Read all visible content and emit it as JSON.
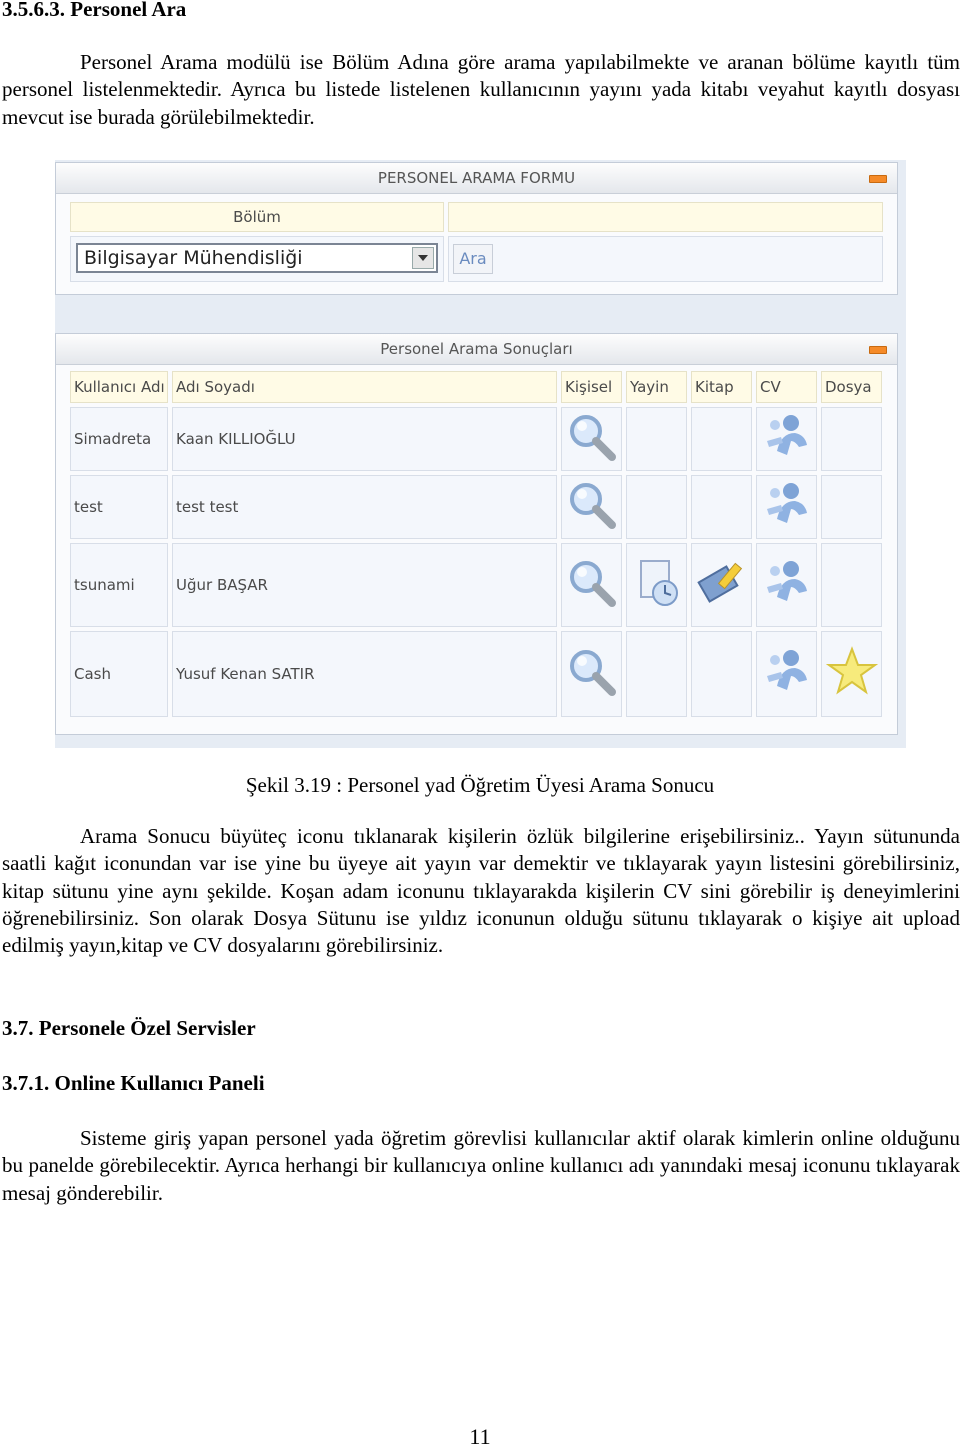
{
  "section_heading": "3.5.6.3. Personel Ara",
  "intro_paragraph": "Personel Arama modülü ise Bölüm Adına göre arama yapılabilmekte ve aranan bölüme kayıtlı tüm personel listelenmektedir. Ayrıca bu listede listelenen kullanıcının yayını yada kitabı veyahut kayıtlı dosyası mevcut ise burada görülebilmektedir.",
  "search_form": {
    "title": "PERSONEL ARAMA FORMU",
    "field_label": "Bölüm",
    "selected_department": "Bilgisayar Mühendisliği",
    "search_button": "Ara"
  },
  "results": {
    "title": "Personel Arama Sonuçları",
    "columns": [
      "Kullanıcı Adı",
      "Adı Soyadı",
      "Kişisel",
      "Yayin",
      "Kitap",
      "CV",
      "Dosya"
    ],
    "rows": [
      {
        "username": "Simadreta",
        "fullname": "Kaan KILLIOĞLU",
        "kisisel": "magnifier-icon",
        "yayin": "",
        "kitap": "",
        "cv": "person-icon",
        "dosya": ""
      },
      {
        "username": "test",
        "fullname": "test test",
        "kisisel": "magnifier-icon",
        "yayin": "",
        "kitap": "",
        "cv": "person-icon",
        "dosya": ""
      },
      {
        "username": "tsunami",
        "fullname": "Uğur BAŞAR",
        "kisisel": "magnifier-icon",
        "yayin": "clock-paper-icon",
        "kitap": "book-pencil-icon",
        "cv": "person-icon",
        "dosya": ""
      },
      {
        "username": "Cash",
        "fullname": "Yusuf Kenan SATIR",
        "kisisel": "magnifier-icon",
        "yayin": "",
        "kitap": "",
        "cv": "person-icon",
        "dosya": "star-icon"
      }
    ]
  },
  "caption": "Şekil 3.19 : Personel yad Öğretim Üyesi Arama Sonucu",
  "explanation_paragraph": "Arama Sonucu büyüteç iconu tıklanarak kişilerin özlük bilgilerine erişebilirsiniz.. Yayın sütununda saatli kağıt iconundan var ise yine bu üyeye ait yayın var demektir ve tıklayarak yayın listesini görebilirsiniz, kitap sütunu yine aynı şekilde. Koşan adam iconunu tıklayarakda kişilerin CV sini görebilir iş deneyimlerini öğrenebilirsiniz. Son olarak Dosya Sütunu ise yıldız iconunun olduğu sütunu tıklayarak o kişiye ait upload edilmiş yayın,kitap ve CV dosyalarını görebilirsiniz.",
  "heading_2": "3.7. Personele Özel Servisler",
  "heading_3": "3.7.1. Online Kullanıcı Paneli",
  "online_paragraph": "Sisteme giriş yapan personel yada öğretim görevlisi kullanıcılar aktif olarak kimlerin online olduğunu bu panelde görebilecektir. Ayrıca herhangi bir kullanıcıya online kullanıcı adı yanındaki mesaj iconunu tıklayarak mesaj gönderebilir.",
  "page_number": "11"
}
